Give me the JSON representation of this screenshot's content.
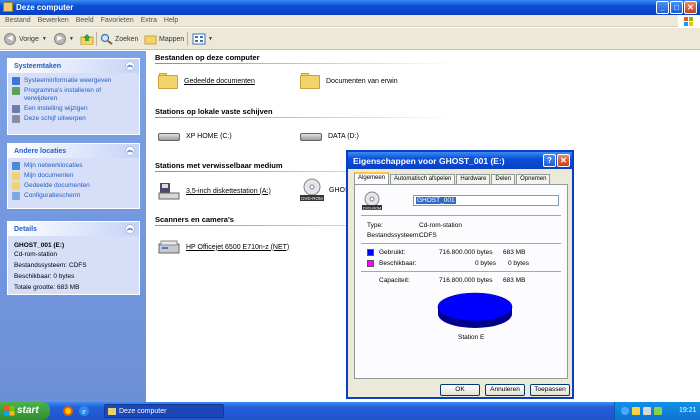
{
  "window": {
    "title": "Deze computer"
  },
  "menu": [
    "Bestand",
    "Bewerken",
    "Beeld",
    "Favorieten",
    "Extra",
    "Help"
  ],
  "toolbar": {
    "back": "Vorige",
    "search": "Zoeken",
    "folders": "Mappen"
  },
  "left_panel": {
    "system_tasks": {
      "title": "Systeemtaken",
      "items": [
        "Systeeminformatie weergeven",
        "Programma's installeren of verwijderen",
        "Een instelling wijzigen",
        "Deze schijf uitwerpen"
      ]
    },
    "other_places": {
      "title": "Andere locaties",
      "items": [
        "Mijn netwerklocaties",
        "Mijn documenten",
        "Gedeelde documenten",
        "Configuratiescherm"
      ]
    },
    "details": {
      "title": "Details",
      "name": "GHOST_001 (E:)",
      "type": "Cd-rom-station",
      "filesystem": "Bestandssysteem: CDFS",
      "free": "Beschikbaar: 0 bytes",
      "total": "Totale grootte: 683 MB"
    }
  },
  "groups": {
    "files": {
      "title": "Bestanden op deze computer",
      "items": [
        "Gedeelde documenten",
        "Documenten van erwin"
      ]
    },
    "fixed": {
      "title": "Stations op lokale vaste schijven",
      "items": [
        "XP HOME (C:)",
        "DATA (D:)"
      ]
    },
    "removable": {
      "title": "Stations met verwisselbaar medium",
      "items": [
        "3,5-inch diskettestation (A:)",
        "GHOST"
      ]
    },
    "scanners": {
      "title": "Scanners en camera's",
      "items": [
        "HP Officejet 6500 E710n-z (NET)"
      ]
    }
  },
  "dialog": {
    "title": "Eigenschappen voor GHOST_001 (E:)",
    "help": "?",
    "close": "✕",
    "tabs": [
      "Algemeen",
      "Automatisch afspelen",
      "Hardware",
      "Delen",
      "Opnemen"
    ],
    "drive_icon_label": "DVD-ROM",
    "name_value": "GHOST_001",
    "type_label": "Type:",
    "type_value": "Cd-rom-station",
    "fs_label": "Bestandssysteem:",
    "fs_value": "CDFS",
    "used_label": "Gebruikt:",
    "used_bytes": "716.800.000 bytes",
    "used_mb": "683 MB",
    "free_label": "Beschikbaar:",
    "free_bytes": "0 bytes",
    "free_mb": "0 bytes",
    "cap_label": "Capaciteit:",
    "cap_bytes": "716.800.000 bytes",
    "cap_mb": "683 MB",
    "station_label": "Station E",
    "ok": "OK",
    "cancel": "Annuleren",
    "apply": "Toepassen"
  },
  "taskbar": {
    "start": "start",
    "window": "Deze computer",
    "clock": "19:21"
  },
  "colors": {
    "used": "#0000ff",
    "free": "#ff00ff",
    "titlebar": "#0a4fd8"
  }
}
